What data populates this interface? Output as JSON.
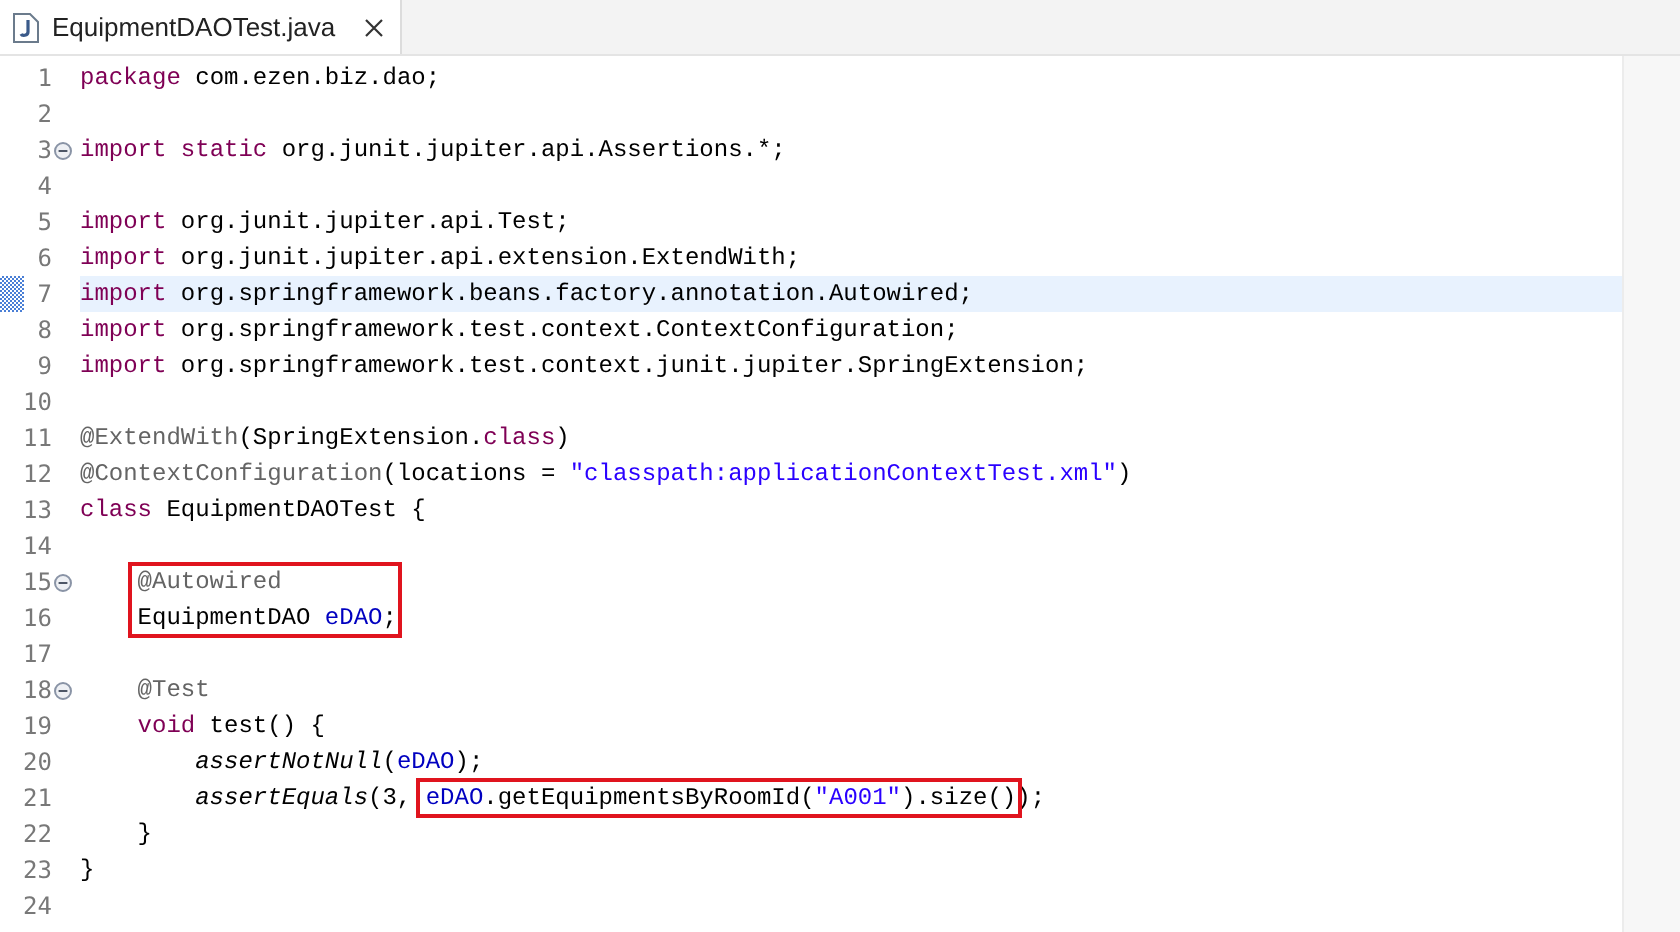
{
  "tab": {
    "title": "EquipmentDAOTest.java",
    "selected": true
  },
  "lines": [
    {
      "number": "1",
      "tokens": [
        {
          "text": "package",
          "kind": "keyword"
        },
        {
          "text": " com.ezen.biz.dao;"
        }
      ]
    },
    {
      "number": "2"
    },
    {
      "number": "3",
      "foldable": true,
      "tokens": [
        {
          "text": "import",
          "kind": "keyword"
        },
        {
          "text": " static",
          "kind": "keyword"
        },
        {
          "text": " org.junit.jupiter.api.Assertions.*;"
        }
      ]
    },
    {
      "number": "4"
    },
    {
      "number": "5",
      "tokens": [
        {
          "text": "import",
          "kind": "keyword"
        },
        {
          "text": " org.junit.jupiter.api.Test;"
        }
      ]
    },
    {
      "number": "6",
      "tokens": [
        {
          "text": "import",
          "kind": "keyword"
        },
        {
          "text": " org.junit.jupiter.api.extension.ExtendWith;"
        }
      ]
    },
    {
      "number": "7",
      "current": true,
      "tokens": [
        {
          "text": "import",
          "kind": "keyword"
        },
        {
          "text": " org.springframework.beans.factory.annotation.Autowired;"
        }
      ]
    },
    {
      "number": "8",
      "tokens": [
        {
          "text": "import",
          "kind": "keyword"
        },
        {
          "text": " org.springframework.test.context.ContextConfiguration;"
        }
      ]
    },
    {
      "number": "9",
      "tokens": [
        {
          "text": "import",
          "kind": "keyword"
        },
        {
          "text": " org.springframework.test.context.junit.jupiter.SpringExtension;"
        }
      ]
    },
    {
      "number": "10"
    },
    {
      "number": "11",
      "tokens": [
        {
          "text": "@ExtendWith",
          "kind": "annotation"
        },
        {
          "text": "(SpringExtension."
        },
        {
          "text": "class",
          "kind": "keyword"
        },
        {
          "text": ")"
        }
      ]
    },
    {
      "number": "12",
      "tokens": [
        {
          "text": "@ContextConfiguration",
          "kind": "annotation"
        },
        {
          "text": "(locations = "
        },
        {
          "text": "\"classpath:applicationContextTest.xml\"",
          "kind": "string"
        },
        {
          "text": ")"
        }
      ]
    },
    {
      "number": "13",
      "tokens": [
        {
          "text": "class",
          "kind": "keyword"
        },
        {
          "text": " EquipmentDAOTest {"
        }
      ],
      "children": [
        {
          "number": "14"
        },
        {
          "number": "15",
          "foldable": true,
          "tokens": [
            {
              "text": "@Autowired",
              "kind": "annotation",
              "boxed": true
            }
          ]
        },
        {
          "number": "16",
          "tokens": [
            {
              "text": "EquipmentDAO ",
              "boxed": true
            },
            {
              "text": "eDAO",
              "kind": "field",
              "boxed": true
            },
            {
              "text": ";",
              "boxed": true
            }
          ]
        },
        {
          "number": "17"
        },
        {
          "number": "18",
          "foldable": true,
          "tokens": [
            {
              "text": "@Test",
              "kind": "annotation"
            }
          ]
        },
        {
          "number": "19",
          "tokens": [
            {
              "text": "void",
              "kind": "keyword"
            },
            {
              "text": " test() {"
            }
          ],
          "children": [
            {
              "number": "20",
              "tokens": [
                {
                  "text": "assertNotNull",
                  "kind": "static"
                },
                {
                  "text": "("
                },
                {
                  "text": "eDAO",
                  "kind": "field"
                },
                {
                  "text": ");"
                }
              ]
            },
            {
              "number": "21",
              "tokens": [
                {
                  "text": "assertEquals",
                  "kind": "static"
                },
                {
                  "text": "(3, "
                },
                {
                  "text": "eDAO",
                  "kind": "field",
                  "boxed": true
                },
                {
                  "text": ".getEquipmentsByRoomId(",
                  "boxed": true
                },
                {
                  "text": "\"A001\"",
                  "kind": "string",
                  "boxed": true
                },
                {
                  "text": ").size()",
                  "boxed": true
                },
                {
                  "text": ");"
                }
              ]
            }
          ]
        },
        {
          "number": "22",
          "tokens": [
            {
              "text": "}"
            }
          ]
        }
      ]
    },
    {
      "number": "23",
      "tokens": [
        {
          "text": "}"
        }
      ]
    },
    {
      "number": "24"
    }
  ]
}
